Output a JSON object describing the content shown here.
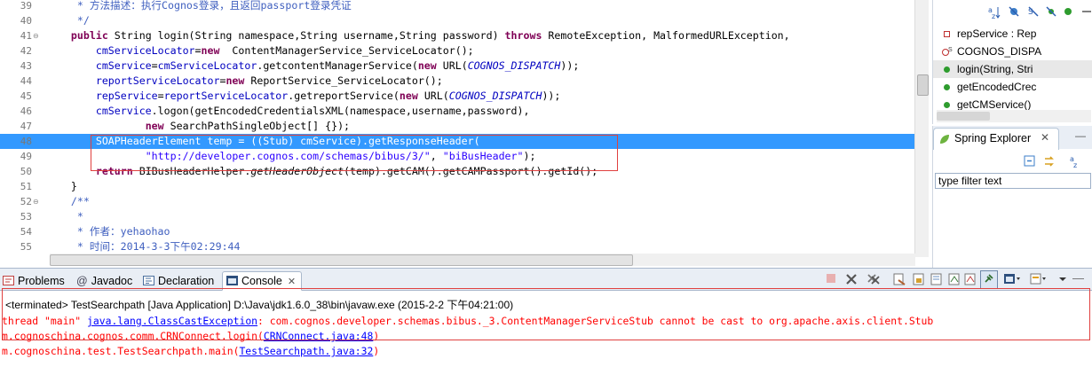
{
  "editor": {
    "lines": [
      {
        "num": "39",
        "fold": "",
        "segs": [
          {
            "t": "     * 方法描述：执行Cognos登录，且返回passport登录凭证",
            "c": "cmt"
          }
        ]
      },
      {
        "num": "40",
        "fold": "",
        "segs": [
          {
            "t": "     */",
            "c": "cmt"
          }
        ]
      },
      {
        "num": "41",
        "fold": "⊖",
        "segs": [
          {
            "t": "    ",
            "c": ""
          },
          {
            "t": "public",
            "c": "kw"
          },
          {
            "t": " String login(String namespace,String username,String password) ",
            "c": ""
          },
          {
            "t": "throws",
            "c": "kw"
          },
          {
            "t": " RemoteException, MalformedURLException,",
            "c": ""
          }
        ]
      },
      {
        "num": "42",
        "fold": "",
        "segs": [
          {
            "t": "        ",
            "c": ""
          },
          {
            "t": "cmServiceLocator",
            "c": "fld"
          },
          {
            "t": "=",
            "c": ""
          },
          {
            "t": "new",
            "c": "kw"
          },
          {
            "t": "  ContentManagerService_ServiceLocator();",
            "c": ""
          }
        ]
      },
      {
        "num": "43",
        "fold": "",
        "segs": [
          {
            "t": "        ",
            "c": ""
          },
          {
            "t": "cmService",
            "c": "fld"
          },
          {
            "t": "=",
            "c": ""
          },
          {
            "t": "cmServiceLocator",
            "c": "fld"
          },
          {
            "t": ".getcontentManagerService(",
            "c": ""
          },
          {
            "t": "new",
            "c": "kw"
          },
          {
            "t": " URL(",
            "c": ""
          },
          {
            "t": "COGNOS_DISPATCH",
            "c": "const"
          },
          {
            "t": "));",
            "c": ""
          }
        ]
      },
      {
        "num": "44",
        "fold": "",
        "segs": [
          {
            "t": "        ",
            "c": ""
          },
          {
            "t": "reportServiceLocator",
            "c": "fld"
          },
          {
            "t": "=",
            "c": ""
          },
          {
            "t": "new",
            "c": "kw"
          },
          {
            "t": " ReportService_ServiceLocator();",
            "c": ""
          }
        ]
      },
      {
        "num": "45",
        "fold": "",
        "segs": [
          {
            "t": "        ",
            "c": ""
          },
          {
            "t": "repService",
            "c": "fld"
          },
          {
            "t": "=",
            "c": ""
          },
          {
            "t": "reportServiceLocator",
            "c": "fld"
          },
          {
            "t": ".getreportService(",
            "c": ""
          },
          {
            "t": "new",
            "c": "kw"
          },
          {
            "t": " URL(",
            "c": ""
          },
          {
            "t": "COGNOS_DISPATCH",
            "c": "const"
          },
          {
            "t": "));",
            "c": ""
          }
        ]
      },
      {
        "num": "46",
        "fold": "",
        "segs": [
          {
            "t": "        ",
            "c": ""
          },
          {
            "t": "cmService",
            "c": "fld"
          },
          {
            "t": ".logon(getEncodedCredentialsXML(namespace,username,password),",
            "c": ""
          }
        ]
      },
      {
        "num": "47",
        "fold": "",
        "segs": [
          {
            "t": "                ",
            "c": ""
          },
          {
            "t": "new",
            "c": "kw"
          },
          {
            "t": " SearchPathSingleObject[] {});",
            "c": ""
          }
        ]
      },
      {
        "num": "48",
        "fold": "",
        "hl": true,
        "segs": [
          {
            "t": "        SOAPHeaderElement temp = ((Stub) cmService).getResponseHeader(",
            "c": ""
          }
        ]
      },
      {
        "num": "49",
        "fold": "",
        "segs": [
          {
            "t": "                ",
            "c": ""
          },
          {
            "t": "\"http://developer.cognos.com/schemas/bibus/3/\"",
            "c": "str"
          },
          {
            "t": ", ",
            "c": ""
          },
          {
            "t": "\"biBusHeader\"",
            "c": "str"
          },
          {
            "t": ");",
            "c": ""
          }
        ]
      },
      {
        "num": "50",
        "fold": "",
        "segs": [
          {
            "t": "        ",
            "c": ""
          },
          {
            "t": "return",
            "c": "kw"
          },
          {
            "t": " BIBusHeaderHelper.",
            "c": ""
          },
          {
            "t": "getHeaderObject",
            "c": "ital"
          },
          {
            "t": "(temp).getCAM().getCAMPassport().getId();",
            "c": ""
          }
        ]
      },
      {
        "num": "51",
        "fold": "",
        "segs": [
          {
            "t": "    }",
            "c": ""
          }
        ]
      },
      {
        "num": "52",
        "fold": "⊖",
        "segs": [
          {
            "t": "    /**",
            "c": "cmt"
          }
        ]
      },
      {
        "num": "53",
        "fold": "",
        "segs": [
          {
            "t": "     *",
            "c": "cmt"
          }
        ]
      },
      {
        "num": "54",
        "fold": "",
        "segs": [
          {
            "t": "     * 作者：yehaohao",
            "c": "cmt"
          }
        ]
      },
      {
        "num": "55",
        "fold": "",
        "segs": [
          {
            "t": "     * 时间：2014-3-3下午02:29:44",
            "c": "cmt"
          }
        ]
      }
    ]
  },
  "outline": {
    "toolbar_icons": [
      "sort-alpha-icon",
      "hide-fields-icon",
      "hide-static-icon",
      "hide-nonpublic-icon",
      "public-icon",
      "collapse-icon",
      "menu-icon"
    ],
    "items": [
      {
        "label": "repService : Rep",
        "marker": "square",
        "color": "#c03030",
        "selected": false
      },
      {
        "label": "COGNOS_DISPA",
        "marker": "static",
        "color": "#c03030",
        "selected": false
      },
      {
        "label": "login(String, Stri",
        "marker": "dot",
        "color": "#2e9c2e",
        "selected": true
      },
      {
        "label": "getEncodedCrec",
        "marker": "dot",
        "color": "#2e9c2e",
        "selected": false
      },
      {
        "label": "getCMService()",
        "marker": "dot",
        "color": "#2e9c2e",
        "selected": false
      }
    ]
  },
  "spring": {
    "tab_label": "Spring Explorer",
    "filter_placeholder": "type filter text"
  },
  "bottom": {
    "tabs": [
      {
        "label": "Problems",
        "icon": "problems-icon",
        "active": false
      },
      {
        "label": "Javadoc",
        "icon": "at-icon",
        "active": false
      },
      {
        "label": "Declaration",
        "icon": "declaration-icon",
        "active": false
      },
      {
        "label": "Console",
        "icon": "console-icon",
        "active": true
      }
    ],
    "console_header": "<terminated> TestSearchpath [Java Application] D:\\Java\\jdk1.6.0_38\\bin\\javaw.exe (2015-2-2 下午04:21:00)",
    "console_lines": [
      [
        {
          "t": "thread \"main\" ",
          "c": "err"
        },
        {
          "t": "java.lang.ClassCastException",
          "c": "link"
        },
        {
          "t": ": com.cognos.developer.schemas.bibus._3.ContentManagerServiceStub cannot be cast to org.apache.axis.client.Stub",
          "c": "err"
        }
      ],
      [
        {
          "t": "m.cognoschina.cognos.comm.CRNConnect.login(",
          "c": "err"
        },
        {
          "t": "CRNConnect.java:48",
          "c": "link"
        },
        {
          "t": ")",
          "c": "err"
        }
      ],
      [
        {
          "t": "m.cognoschina.test.TestSearchpath.main(",
          "c": "err"
        },
        {
          "t": "TestSearchpath.java:32",
          "c": "link"
        },
        {
          "t": ")",
          "c": "err"
        }
      ]
    ]
  }
}
